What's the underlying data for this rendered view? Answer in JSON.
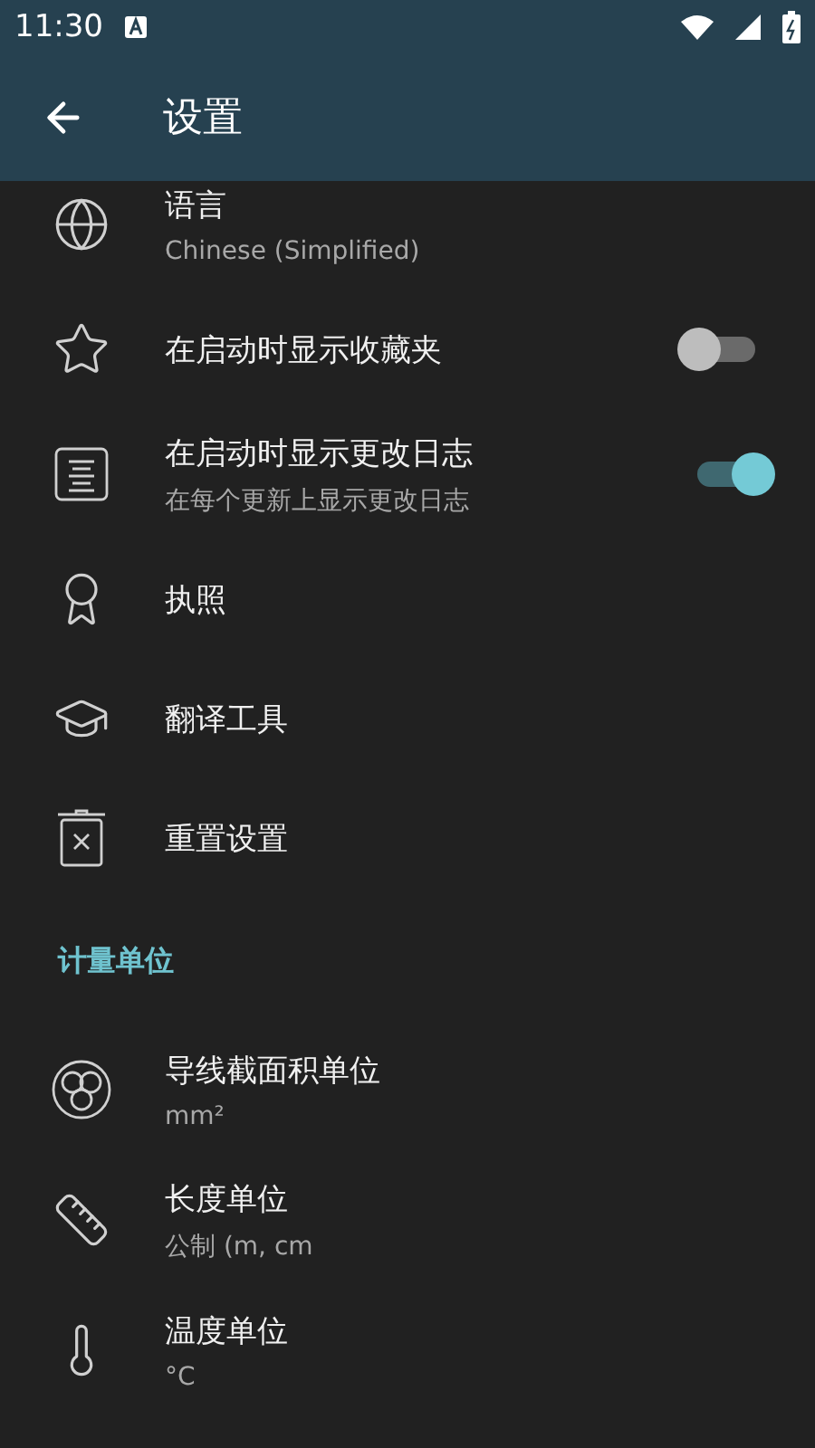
{
  "status_bar": {
    "time": "11:30"
  },
  "app_bar": {
    "title": "设置"
  },
  "sections": [
    {
      "items": [
        {
          "kind": "plain",
          "title": "语言",
          "subtitle": "Chinese (Simplified)"
        },
        {
          "kind": "toggle",
          "title": "在启动时显示收藏夹",
          "on": false
        },
        {
          "kind": "toggle",
          "title": "在启动时显示更改日志",
          "subtitle": "在每个更新上显示更改日志",
          "on": true
        },
        {
          "kind": "plain",
          "title": "执照"
        },
        {
          "kind": "plain",
          "title": "翻译工具"
        },
        {
          "kind": "plain",
          "title": "重置设置"
        }
      ]
    },
    {
      "header": "计量单位",
      "items": [
        {
          "kind": "plain",
          "title": "导线截面积单位",
          "subtitle": "mm²"
        },
        {
          "kind": "plain",
          "title": "长度单位",
          "subtitle": "公制 (m, cm"
        },
        {
          "kind": "plain",
          "title": "温度单位",
          "subtitle": "°C"
        }
      ]
    }
  ]
}
